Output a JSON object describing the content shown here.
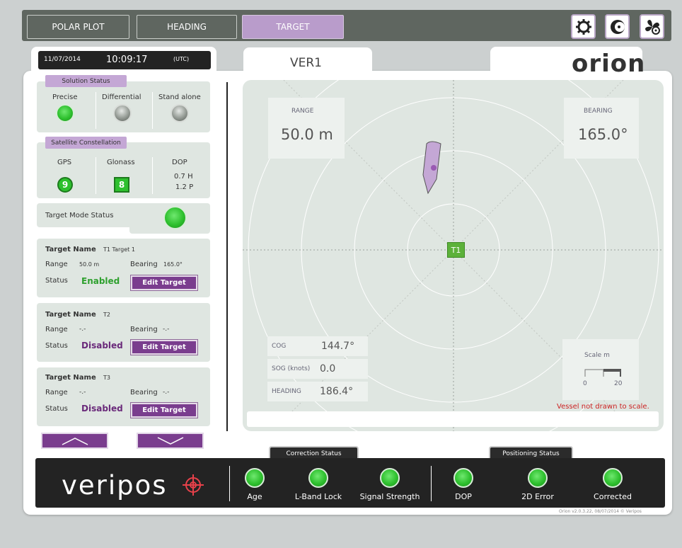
{
  "top_tabs": [
    "POLAR PLOT",
    "HEADING",
    "TARGET"
  ],
  "top_buttons": [
    "gear-icon",
    "moon-icon",
    "fan-icon"
  ],
  "clock": {
    "date": "11/07/2014",
    "time": "10:09:17",
    "zone": "(UTC)"
  },
  "vessel_tab": "VER1",
  "brand": {
    "orion": "orion",
    "veripos": "veripos"
  },
  "solution_status": {
    "title": "Solution Status",
    "items": [
      {
        "label": "Precise",
        "state": "green"
      },
      {
        "label": "Differential",
        "state": "grey"
      },
      {
        "label": "Stand alone",
        "state": "grey"
      }
    ]
  },
  "satellite": {
    "title": "Satellite Constellation",
    "gps_label": "GPS",
    "gps_count": "9",
    "glonass_label": "Glonass",
    "glonass_count": "8",
    "dop_label": "DOP",
    "dop_h": "0.7 H",
    "dop_p": "1.2 P"
  },
  "target_mode": {
    "label": "Target Mode Status",
    "state": "green"
  },
  "targets": [
    {
      "name_label": "Target Name",
      "name": "T1 Target 1",
      "range_label": "Range",
      "range": "50.0 m",
      "bearing_label": "Bearing",
      "bearing": "165.0°",
      "status_label": "Status",
      "status": "Enabled",
      "button": "Edit Target"
    },
    {
      "name_label": "Target Name",
      "name": "T2",
      "range_label": "Range",
      "range": "-.-",
      "bearing_label": "Bearing",
      "bearing": "-.-",
      "status_label": "Status",
      "status": "Disabled",
      "button": "Edit Target"
    },
    {
      "name_label": "Target Name",
      "name": "T3",
      "range_label": "Range",
      "range": "-.-",
      "bearing_label": "Bearing",
      "bearing": "-.-",
      "status_label": "Status",
      "status": "Disabled",
      "button": "Edit Target"
    }
  ],
  "plot": {
    "range_label": "RANGE",
    "range_value": "50.0 m",
    "bearing_label": "BEARING",
    "bearing_value": "165.0°",
    "target_marker": "T1",
    "cog_label": "COG",
    "cog_value": "144.7°",
    "sog_label": "SOG (knots)",
    "sog_value": "0.0",
    "heading_label": "HEADING",
    "heading_value": "186.4°",
    "scale_label": "Scale  m",
    "scale_min": "0",
    "scale_max": "20",
    "warning": "Vessel not drawn to scale."
  },
  "correction_status": {
    "title": "Correction Status",
    "items": [
      {
        "label": "Age"
      },
      {
        "label": "L-Band Lock"
      },
      {
        "label": "Signal Strength"
      }
    ]
  },
  "positioning_status": {
    "title": "Positioning Status",
    "items": [
      {
        "label": "DOP"
      },
      {
        "label": "2D Error"
      },
      {
        "label": "Corrected"
      }
    ]
  },
  "footer_version": "Orion v2.0.3.22, 08/07/2014 © Veripos",
  "colors": {
    "accent": "#7a3d8e",
    "enabled": "#2ea02e",
    "disabled": "#6a2a7a",
    "warning": "#cc2222"
  }
}
